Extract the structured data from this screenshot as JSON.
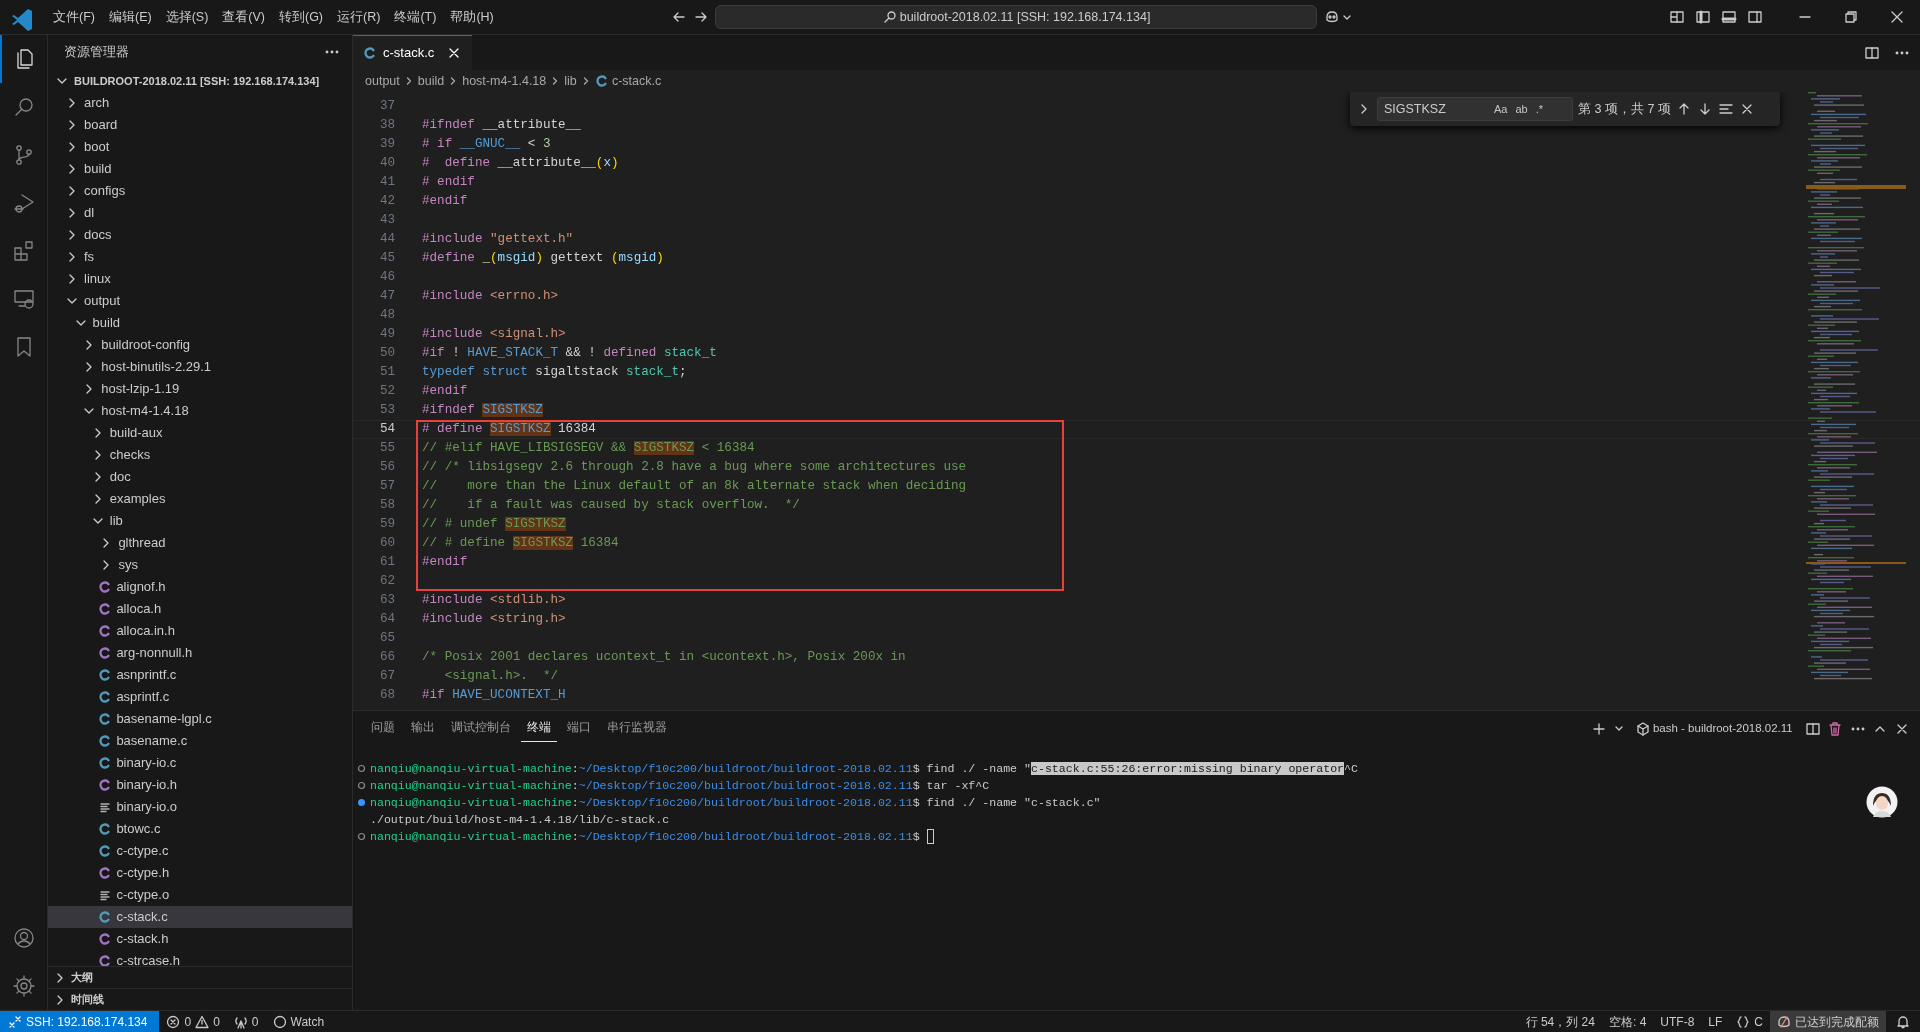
{
  "title_bar": {
    "menus": [
      "文件(F)",
      "编辑(E)",
      "选择(S)",
      "查看(V)",
      "转到(G)",
      "运行(R)",
      "终端(T)",
      "帮助(H)"
    ],
    "command_center": "buildroot-2018.02.11 [SSH: 192.168.174.134]"
  },
  "activity_bar": {
    "top": [
      {
        "kind": "explorer",
        "selected": true
      },
      {
        "kind": "search",
        "selected": false
      },
      {
        "kind": "source-control",
        "selected": false
      },
      {
        "kind": "run-debug",
        "selected": false
      },
      {
        "kind": "extensions",
        "selected": false
      },
      {
        "kind": "remote",
        "selected": false
      },
      {
        "kind": "bookmark",
        "selected": false
      }
    ],
    "bottom": [
      {
        "kind": "account",
        "selected": false
      },
      {
        "kind": "settings",
        "selected": false
      }
    ]
  },
  "sidebar": {
    "title": "资源管理器",
    "root": {
      "label": "BUILDROOT-2018.02.11 [SSH: 192.168.174.134]",
      "expanded": true
    },
    "items": [
      {
        "label": "arch",
        "kind": "folder",
        "expanded": false,
        "selected": false
      },
      {
        "label": "board",
        "kind": "folder",
        "expanded": false,
        "selected": false
      },
      {
        "label": "boot",
        "kind": "folder",
        "expanded": false,
        "selected": false
      },
      {
        "label": "build",
        "kind": "folder",
        "expanded": false,
        "selected": false
      },
      {
        "label": "configs",
        "kind": "folder",
        "expanded": false,
        "selected": false
      },
      {
        "label": "dl",
        "kind": "folder",
        "expanded": false,
        "selected": false
      },
      {
        "label": "docs",
        "kind": "folder",
        "expanded": false,
        "selected": false
      },
      {
        "label": "fs",
        "kind": "folder",
        "expanded": false,
        "selected": false
      },
      {
        "label": "linux",
        "kind": "folder",
        "expanded": false,
        "selected": false
      },
      {
        "label": "output",
        "kind": "folder",
        "expanded": true,
        "selected": false,
        "children": [
          {
            "label": "build",
            "kind": "folder",
            "expanded": true,
            "selected": false,
            "children": [
              {
                "label": "buildroot-config",
                "kind": "folder",
                "expanded": false,
                "selected": false
              },
              {
                "label": "host-binutils-2.29.1",
                "kind": "folder",
                "expanded": false,
                "selected": false
              },
              {
                "label": "host-lzip-1.19",
                "kind": "folder",
                "expanded": false,
                "selected": false
              },
              {
                "label": "host-m4-1.4.18",
                "kind": "folder",
                "expanded": true,
                "selected": false,
                "children": [
                  {
                    "label": "build-aux",
                    "kind": "folder",
                    "expanded": false,
                    "selected": false
                  },
                  {
                    "label": "checks",
                    "kind": "folder",
                    "expanded": false,
                    "selected": false
                  },
                  {
                    "label": "doc",
                    "kind": "folder",
                    "expanded": false,
                    "selected": false
                  },
                  {
                    "label": "examples",
                    "kind": "folder",
                    "expanded": false,
                    "selected": false
                  },
                  {
                    "label": "lib",
                    "kind": "folder",
                    "expanded": true,
                    "selected": false,
                    "children": [
                      {
                        "label": "glthread",
                        "kind": "folder",
                        "expanded": false,
                        "selected": false
                      },
                      {
                        "label": "sys",
                        "kind": "folder",
                        "expanded": false,
                        "selected": false
                      },
                      {
                        "label": "alignof.h",
                        "kind": "c-header",
                        "selected": false
                      },
                      {
                        "label": "alloca.h",
                        "kind": "c-header",
                        "selected": false
                      },
                      {
                        "label": "alloca.in.h",
                        "kind": "c-header",
                        "selected": false
                      },
                      {
                        "label": "arg-nonnull.h",
                        "kind": "c-header",
                        "selected": false
                      },
                      {
                        "label": "asnprintf.c",
                        "kind": "c-source",
                        "selected": false
                      },
                      {
                        "label": "asprintf.c",
                        "kind": "c-source",
                        "selected": false
                      },
                      {
                        "label": "basename-lgpl.c",
                        "kind": "c-source",
                        "selected": false
                      },
                      {
                        "label": "basename.c",
                        "kind": "c-source",
                        "selected": false
                      },
                      {
                        "label": "binary-io.c",
                        "kind": "c-source",
                        "selected": false
                      },
                      {
                        "label": "binary-io.h",
                        "kind": "c-header",
                        "selected": false
                      },
                      {
                        "label": "binary-io.o",
                        "kind": "object",
                        "selected": false
                      },
                      {
                        "label": "btowc.c",
                        "kind": "c-source",
                        "selected": false
                      },
                      {
                        "label": "c-ctype.c",
                        "kind": "c-source",
                        "selected": false
                      },
                      {
                        "label": "c-ctype.h",
                        "kind": "c-header",
                        "selected": false
                      },
                      {
                        "label": "c-ctype.o",
                        "kind": "object",
                        "selected": false
                      },
                      {
                        "label": "c-stack.c",
                        "kind": "c-source",
                        "selected": true
                      },
                      {
                        "label": "c-stack.h",
                        "kind": "c-header",
                        "selected": false
                      },
                      {
                        "label": "c-strcase.h",
                        "kind": "c-header",
                        "selected": false
                      }
                    ]
                  }
                ]
              }
            ]
          }
        ]
      }
    ],
    "sections": [
      {
        "label": "大纲",
        "expanded": false
      },
      {
        "label": "时间线",
        "expanded": false
      }
    ]
  },
  "editor": {
    "tabs": [
      {
        "label": "c-stack.c",
        "kind": "c-source",
        "selected": true
      }
    ],
    "breadcrumbs": [
      "output",
      "build",
      "host-m4-1.4.18",
      "lib"
    ],
    "breadcrumb_file": {
      "label": "c-stack.c",
      "kind": "c-source"
    },
    "find": {
      "expanded": false,
      "value": "SIGSTKSZ",
      "options": [
        {
          "label": "Aa",
          "on": false
        },
        {
          "label": "ab",
          "on": false
        },
        {
          "label": ".*",
          "on": false
        }
      ],
      "result": "第 3 项，共 7 项"
    },
    "lines": [
      {
        "number": "37",
        "current": false,
        "boxed": false
      },
      {
        "number": "38",
        "current": false,
        "boxed": false,
        "tokens": [
          {
            "t": "#ifndef ",
            "kind": "pre"
          },
          {
            "t": "__attribute__",
            "kind": "plain"
          }
        ]
      },
      {
        "number": "39",
        "current": false,
        "boxed": false,
        "tokens": [
          {
            "t": "# if ",
            "kind": "pre"
          },
          {
            "t": "__GNUC__",
            "kind": "macro"
          },
          {
            "t": " < ",
            "kind": "plain"
          },
          {
            "t": "3",
            "kind": "num"
          }
        ]
      },
      {
        "number": "40",
        "current": false,
        "boxed": false,
        "tokens": [
          {
            "t": "#  define ",
            "kind": "pre"
          },
          {
            "t": "__attribute__",
            "kind": "plain"
          },
          {
            "t": "(",
            "kind": "paren"
          },
          {
            "t": "x",
            "kind": "var"
          },
          {
            "t": ")",
            "kind": "paren"
          }
        ]
      },
      {
        "number": "41",
        "current": false,
        "boxed": false,
        "tokens": [
          {
            "t": "# endif",
            "kind": "pre"
          }
        ]
      },
      {
        "number": "42",
        "current": false,
        "boxed": false,
        "tokens": [
          {
            "t": "#endif",
            "kind": "pre"
          }
        ]
      },
      {
        "number": "43",
        "current": false,
        "boxed": false
      },
      {
        "number": "44",
        "current": false,
        "boxed": false,
        "tokens": [
          {
            "t": "#include ",
            "kind": "pre"
          },
          {
            "t": "\"gettext.h\"",
            "kind": "str"
          }
        ]
      },
      {
        "number": "45",
        "current": false,
        "boxed": false,
        "tokens": [
          {
            "t": "#define ",
            "kind": "pre"
          },
          {
            "t": "_",
            "kind": "fn"
          },
          {
            "t": "(",
            "kind": "paren"
          },
          {
            "t": "msgid",
            "kind": "var"
          },
          {
            "t": ")",
            "kind": "paren"
          },
          {
            "t": " gettext ",
            "kind": "plain"
          },
          {
            "t": "(",
            "kind": "paren"
          },
          {
            "t": "msgid",
            "kind": "var"
          },
          {
            "t": ")",
            "kind": "paren"
          }
        ]
      },
      {
        "number": "46",
        "current": false,
        "boxed": false
      },
      {
        "number": "47",
        "current": false,
        "boxed": false,
        "tokens": [
          {
            "t": "#include ",
            "kind": "pre"
          },
          {
            "t": "<errno.h>",
            "kind": "str"
          }
        ]
      },
      {
        "number": "48",
        "current": false,
        "boxed": false
      },
      {
        "number": "49",
        "current": false,
        "boxed": false,
        "tokens": [
          {
            "t": "#include ",
            "kind": "pre"
          },
          {
            "t": "<signal.h>",
            "kind": "str"
          }
        ]
      },
      {
        "number": "50",
        "current": false,
        "boxed": false,
        "tokens": [
          {
            "t": "#if ",
            "kind": "pre"
          },
          {
            "t": "! ",
            "kind": "plain"
          },
          {
            "t": "HAVE_STACK_T",
            "kind": "macro"
          },
          {
            "t": " && ! ",
            "kind": "plain"
          },
          {
            "t": "defined ",
            "kind": "pre"
          },
          {
            "t": "stack_t",
            "kind": "type"
          }
        ]
      },
      {
        "number": "51",
        "current": false,
        "boxed": false,
        "tokens": [
          {
            "t": "typedef struct",
            "kind": "kw"
          },
          {
            "t": " sigaltstack ",
            "kind": "plain"
          },
          {
            "t": "stack_t",
            "kind": "type"
          },
          {
            "t": ";",
            "kind": "plain"
          }
        ]
      },
      {
        "number": "52",
        "current": false,
        "boxed": false,
        "tokens": [
          {
            "t": "#endif",
            "kind": "pre"
          }
        ]
      },
      {
        "number": "53",
        "current": false,
        "boxed": false,
        "tokens": [
          {
            "t": "#ifndef ",
            "kind": "pre"
          },
          {
            "t": "SIGSTKSZ",
            "kind": "match-macro"
          }
        ]
      },
      {
        "number": "54",
        "current": true,
        "boxed": true,
        "tokens": [
          {
            "t": "# define ",
            "kind": "pre"
          },
          {
            "t": "SIGSTKSZ",
            "kind": "match-macro"
          },
          {
            "t": " 16384",
            "kind": "plain"
          }
        ]
      },
      {
        "number": "55",
        "current": false,
        "boxed": true,
        "tokens": [
          {
            "t": "// #elif HAVE_LIBSIGSEGV && ",
            "kind": "cmt"
          },
          {
            "t": "SIGSTKSZ",
            "kind": "match-comment"
          },
          {
            "t": " < 16384",
            "kind": "cmt"
          }
        ]
      },
      {
        "number": "56",
        "current": false,
        "boxed": true,
        "tokens": [
          {
            "t": "// /* libsigsegv 2.6 through 2.8 have a bug where some architectures use",
            "kind": "cmt"
          }
        ]
      },
      {
        "number": "57",
        "current": false,
        "boxed": true,
        "tokens": [
          {
            "t": "//    more than the Linux default of an 8k alternate stack when deciding",
            "kind": "cmt"
          }
        ]
      },
      {
        "number": "58",
        "current": false,
        "boxed": true,
        "tokens": [
          {
            "t": "//    if a fault was caused by stack overflow.  */",
            "kind": "cmt"
          }
        ]
      },
      {
        "number": "59",
        "current": false,
        "boxed": true,
        "tokens": [
          {
            "t": "// # undef ",
            "kind": "cmt"
          },
          {
            "t": "SIGSTKSZ",
            "kind": "match-comment"
          }
        ]
      },
      {
        "number": "60",
        "current": false,
        "boxed": true,
        "tokens": [
          {
            "t": "// # define ",
            "kind": "cmt"
          },
          {
            "t": "SIGSTKSZ",
            "kind": "match-comment"
          },
          {
            "t": " 16384",
            "kind": "cmt"
          }
        ]
      },
      {
        "number": "61",
        "current": false,
        "boxed": true,
        "tokens": [
          {
            "t": "#endif",
            "kind": "pre"
          }
        ]
      },
      {
        "number": "62",
        "current": false,
        "boxed": true
      },
      {
        "number": "63",
        "current": false,
        "boxed": false,
        "tokens": [
          {
            "t": "#include ",
            "kind": "pre"
          },
          {
            "t": "<stdlib.h>",
            "kind": "str"
          }
        ]
      },
      {
        "number": "64",
        "current": false,
        "boxed": false,
        "tokens": [
          {
            "t": "#include ",
            "kind": "pre"
          },
          {
            "t": "<string.h>",
            "kind": "str"
          }
        ]
      },
      {
        "number": "65",
        "current": false,
        "boxed": false
      },
      {
        "number": "66",
        "current": false,
        "boxed": false,
        "tokens": [
          {
            "t": "/* Posix 2001 declares ucontext_t in <ucontext.h>, Posix 200x in",
            "kind": "cmt"
          }
        ]
      },
      {
        "number": "67",
        "current": false,
        "boxed": false,
        "tokens": [
          {
            "t": "   <signal.h>.  */",
            "kind": "cmt"
          }
        ]
      },
      {
        "number": "68",
        "current": false,
        "boxed": false,
        "tokens": [
          {
            "t": "#if ",
            "kind": "pre"
          },
          {
            "t": "HAVE_UCONTEXT_H",
            "kind": "macro"
          }
        ]
      }
    ]
  },
  "panel": {
    "tabs": [
      {
        "label": "问题",
        "selected": false
      },
      {
        "label": "输出",
        "selected": false
      },
      {
        "label": "调试控制台",
        "selected": false
      },
      {
        "label": "终端",
        "selected": true
      },
      {
        "label": "端口",
        "selected": false
      },
      {
        "label": "串行监视器",
        "selected": false
      }
    ],
    "terminal_name": "bash - buildroot-2018.02.11",
    "lines": [
      {
        "kind": "done",
        "cursor": false,
        "segments": [
          {
            "t": "nanqiu@nanqiu-virtual-machine",
            "kind": "user"
          },
          {
            "t": ":",
            "kind": "plain"
          },
          {
            "t": "~/Desktop/f10c200/buildroot/buildroot-2018.02.11",
            "kind": "path"
          },
          {
            "t": "$ find ./ -name \"",
            "kind": "plain"
          },
          {
            "t": "c-stack.c:55:26:error:missing binary operator",
            "kind": "selection"
          },
          {
            "t": "^C",
            "kind": "plain"
          }
        ]
      },
      {
        "kind": "done",
        "cursor": false,
        "segments": [
          {
            "t": "nanqiu@nanqiu-virtual-machine",
            "kind": "user"
          },
          {
            "t": ":",
            "kind": "plain"
          },
          {
            "t": "~/Desktop/f10c200/buildroot/buildroot-2018.02.11",
            "kind": "path"
          },
          {
            "t": "$ tar -xf^C",
            "kind": "plain"
          }
        ]
      },
      {
        "kind": "running",
        "cursor": false,
        "segments": [
          {
            "t": "nanqiu@nanqiu-virtual-machine",
            "kind": "user"
          },
          {
            "t": ":",
            "kind": "plain"
          },
          {
            "t": "~/Desktop/f10c200/buildroot/buildroot-2018.02.11",
            "kind": "path"
          },
          {
            "t": "$ find ./ -name \"c-stack.c\"",
            "kind": "plain"
          }
        ]
      },
      {
        "kind": "plain",
        "cursor": false,
        "segments": [
          {
            "t": "./output/build/host-m4-1.4.18/lib/c-stack.c",
            "kind": "plain"
          }
        ]
      },
      {
        "kind": "done",
        "cursor": true,
        "segments": [
          {
            "t": "nanqiu@nanqiu-virtual-machine",
            "kind": "user"
          },
          {
            "t": ":",
            "kind": "plain"
          },
          {
            "t": "~/Desktop/f10c200/buildroot/buildroot-2018.02.11",
            "kind": "path"
          },
          {
            "t": "$ ",
            "kind": "plain"
          }
        ]
      }
    ]
  },
  "status_bar": {
    "remote": "SSH: 192.168.174.134",
    "errors": "0",
    "warnings": "0",
    "ports": "0",
    "watch": "Watch",
    "position": "行 54，列 24",
    "indent": "空格: 4",
    "encoding": "UTF-8",
    "eol": "LF",
    "language": "C",
    "quota": "已达到完成配额"
  }
}
